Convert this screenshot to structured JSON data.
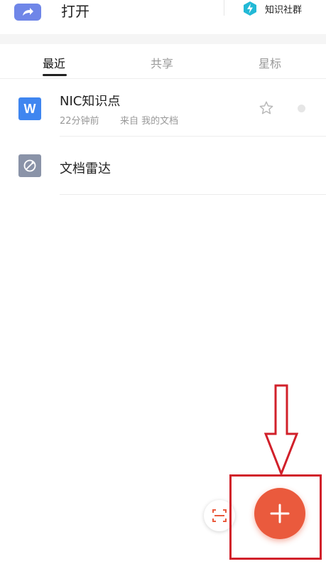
{
  "topbar": {
    "open_label": "打开",
    "community_label": "知识社群"
  },
  "tabs": [
    {
      "label": "最近",
      "active": true
    },
    {
      "label": "共享",
      "active": false
    },
    {
      "label": "星标",
      "active": false
    }
  ],
  "files": [
    {
      "title": "NIC知识点",
      "meta_time": "22分钟前",
      "meta_source": "来自 我的文档",
      "type_letter": "W",
      "icon_color": "#3f86f0"
    },
    {
      "title": "文档雷达",
      "icon_color": "#8a93a8"
    }
  ],
  "colors": {
    "accent": "#ea5a3d",
    "annotation": "#d1202a",
    "open_icon": "#6f86e8",
    "community_icon": "#22b9d6"
  }
}
